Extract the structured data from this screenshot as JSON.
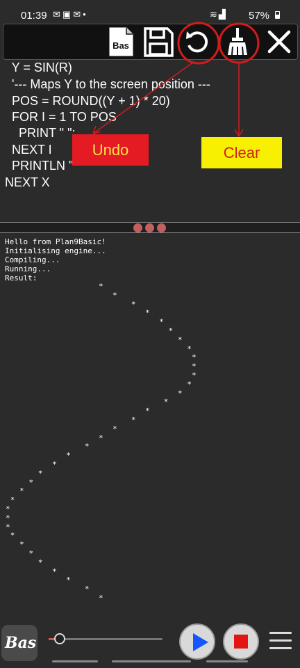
{
  "status_bar": {
    "time": "01:39",
    "battery": "57%",
    "left_icons": [
      "mail-icon",
      "image-icon",
      "mail-icon",
      "dot-icon"
    ],
    "right_icons": [
      "wifi-icon",
      "signal-icon",
      "battery-icon"
    ]
  },
  "toolbar": {
    "bas_label": "Bas",
    "buttons": [
      "bas-file-icon",
      "save-icon",
      "undo-icon",
      "broom-icon",
      "close-icon"
    ]
  },
  "editor": {
    "lines": [
      "  Y = SIN(R)",
      "  '--- Maps Y to the screen position ---",
      "  POS = ROUND((Y + 1) * 20)",
      "  FOR I = 1 TO POS",
      "    PRINT \" \";",
      "  NEXT I",
      "  PRINTLN \"*\"",
      "NEXT X"
    ]
  },
  "annotations": {
    "undo_label": "Undo",
    "clear_label": "Clear",
    "undo_color": "#e51b24",
    "clear_color": "#f7f000"
  },
  "console": {
    "lines": [
      "Hello from Plan9Basic!",
      "Initialising engine...",
      "Compiling...",
      "Running...",
      "Result:"
    ],
    "star_char": "*",
    "star_spaces": [
      20,
      23,
      27,
      30,
      33,
      35,
      37,
      39,
      40,
      40,
      40,
      39,
      37,
      34,
      30,
      27,
      23,
      20,
      17,
      13,
      10,
      7,
      5,
      3,
      1,
      0,
      0,
      0,
      1,
      3,
      5,
      7,
      10,
      13,
      17,
      20
    ]
  },
  "bottom_bar": {
    "logo_label": "Bas",
    "slider_value": 0.1,
    "buttons": [
      "play-icon",
      "stop-icon",
      "menu-icon"
    ],
    "accent_play": "#1457ff",
    "accent_stop": "#e31414"
  }
}
